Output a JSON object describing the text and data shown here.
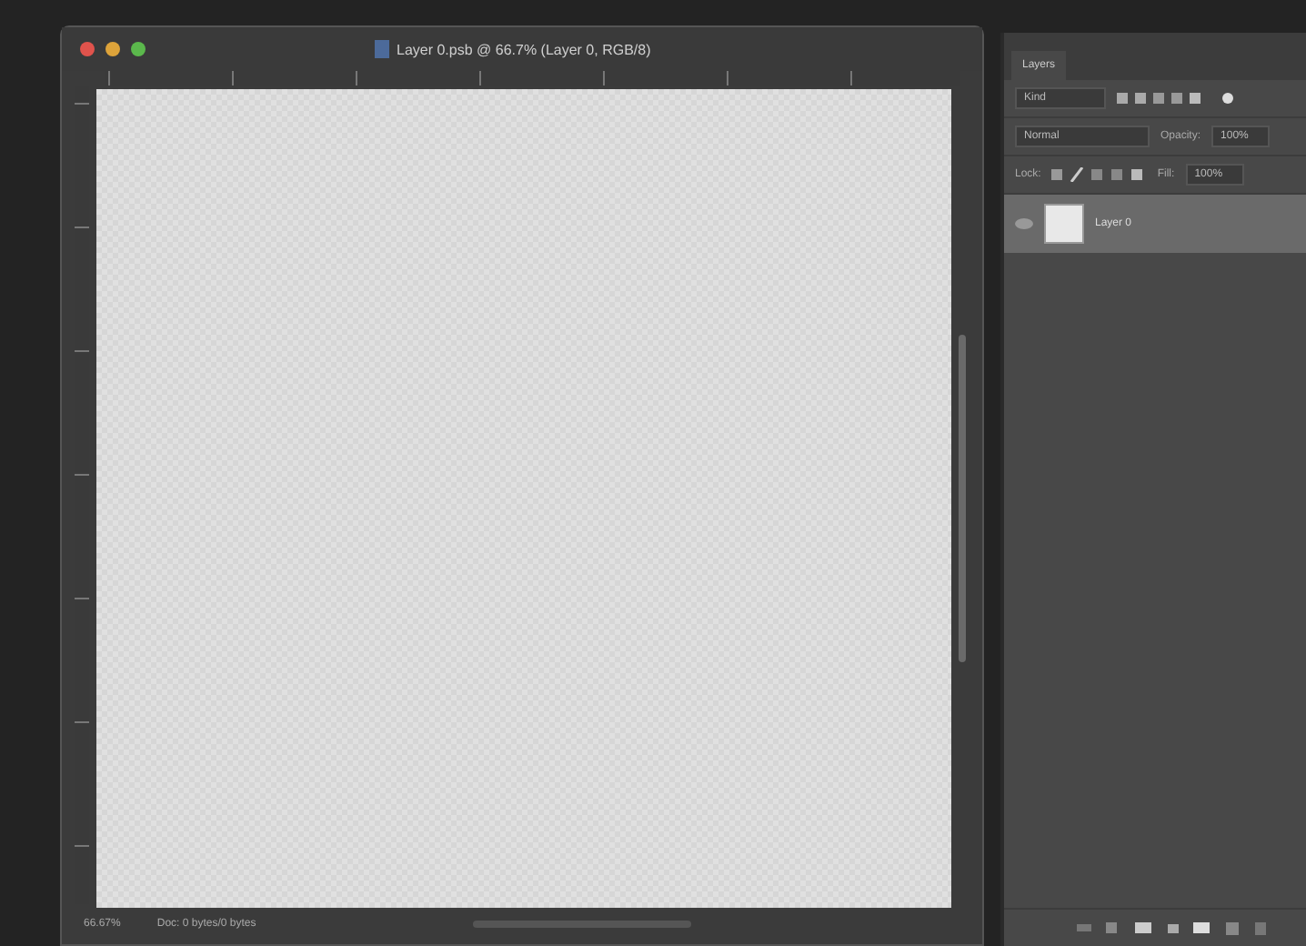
{
  "document": {
    "title": "Layer 0.psb @ 66.7% (Layer 0, RGB/8)",
    "zoom": "66.67%",
    "doc_info": "Doc: 0 bytes/0 bytes"
  },
  "layers_panel": {
    "tab": "Layers",
    "filter": "Kind",
    "blend_mode": "Normal",
    "opacity_label": "Opacity:",
    "opacity": "100%",
    "lock_label": "Lock:",
    "fill_label": "Fill:",
    "fill": "100%",
    "layers": [
      {
        "name": "Layer 0",
        "visible": true,
        "selected": true
      }
    ]
  }
}
